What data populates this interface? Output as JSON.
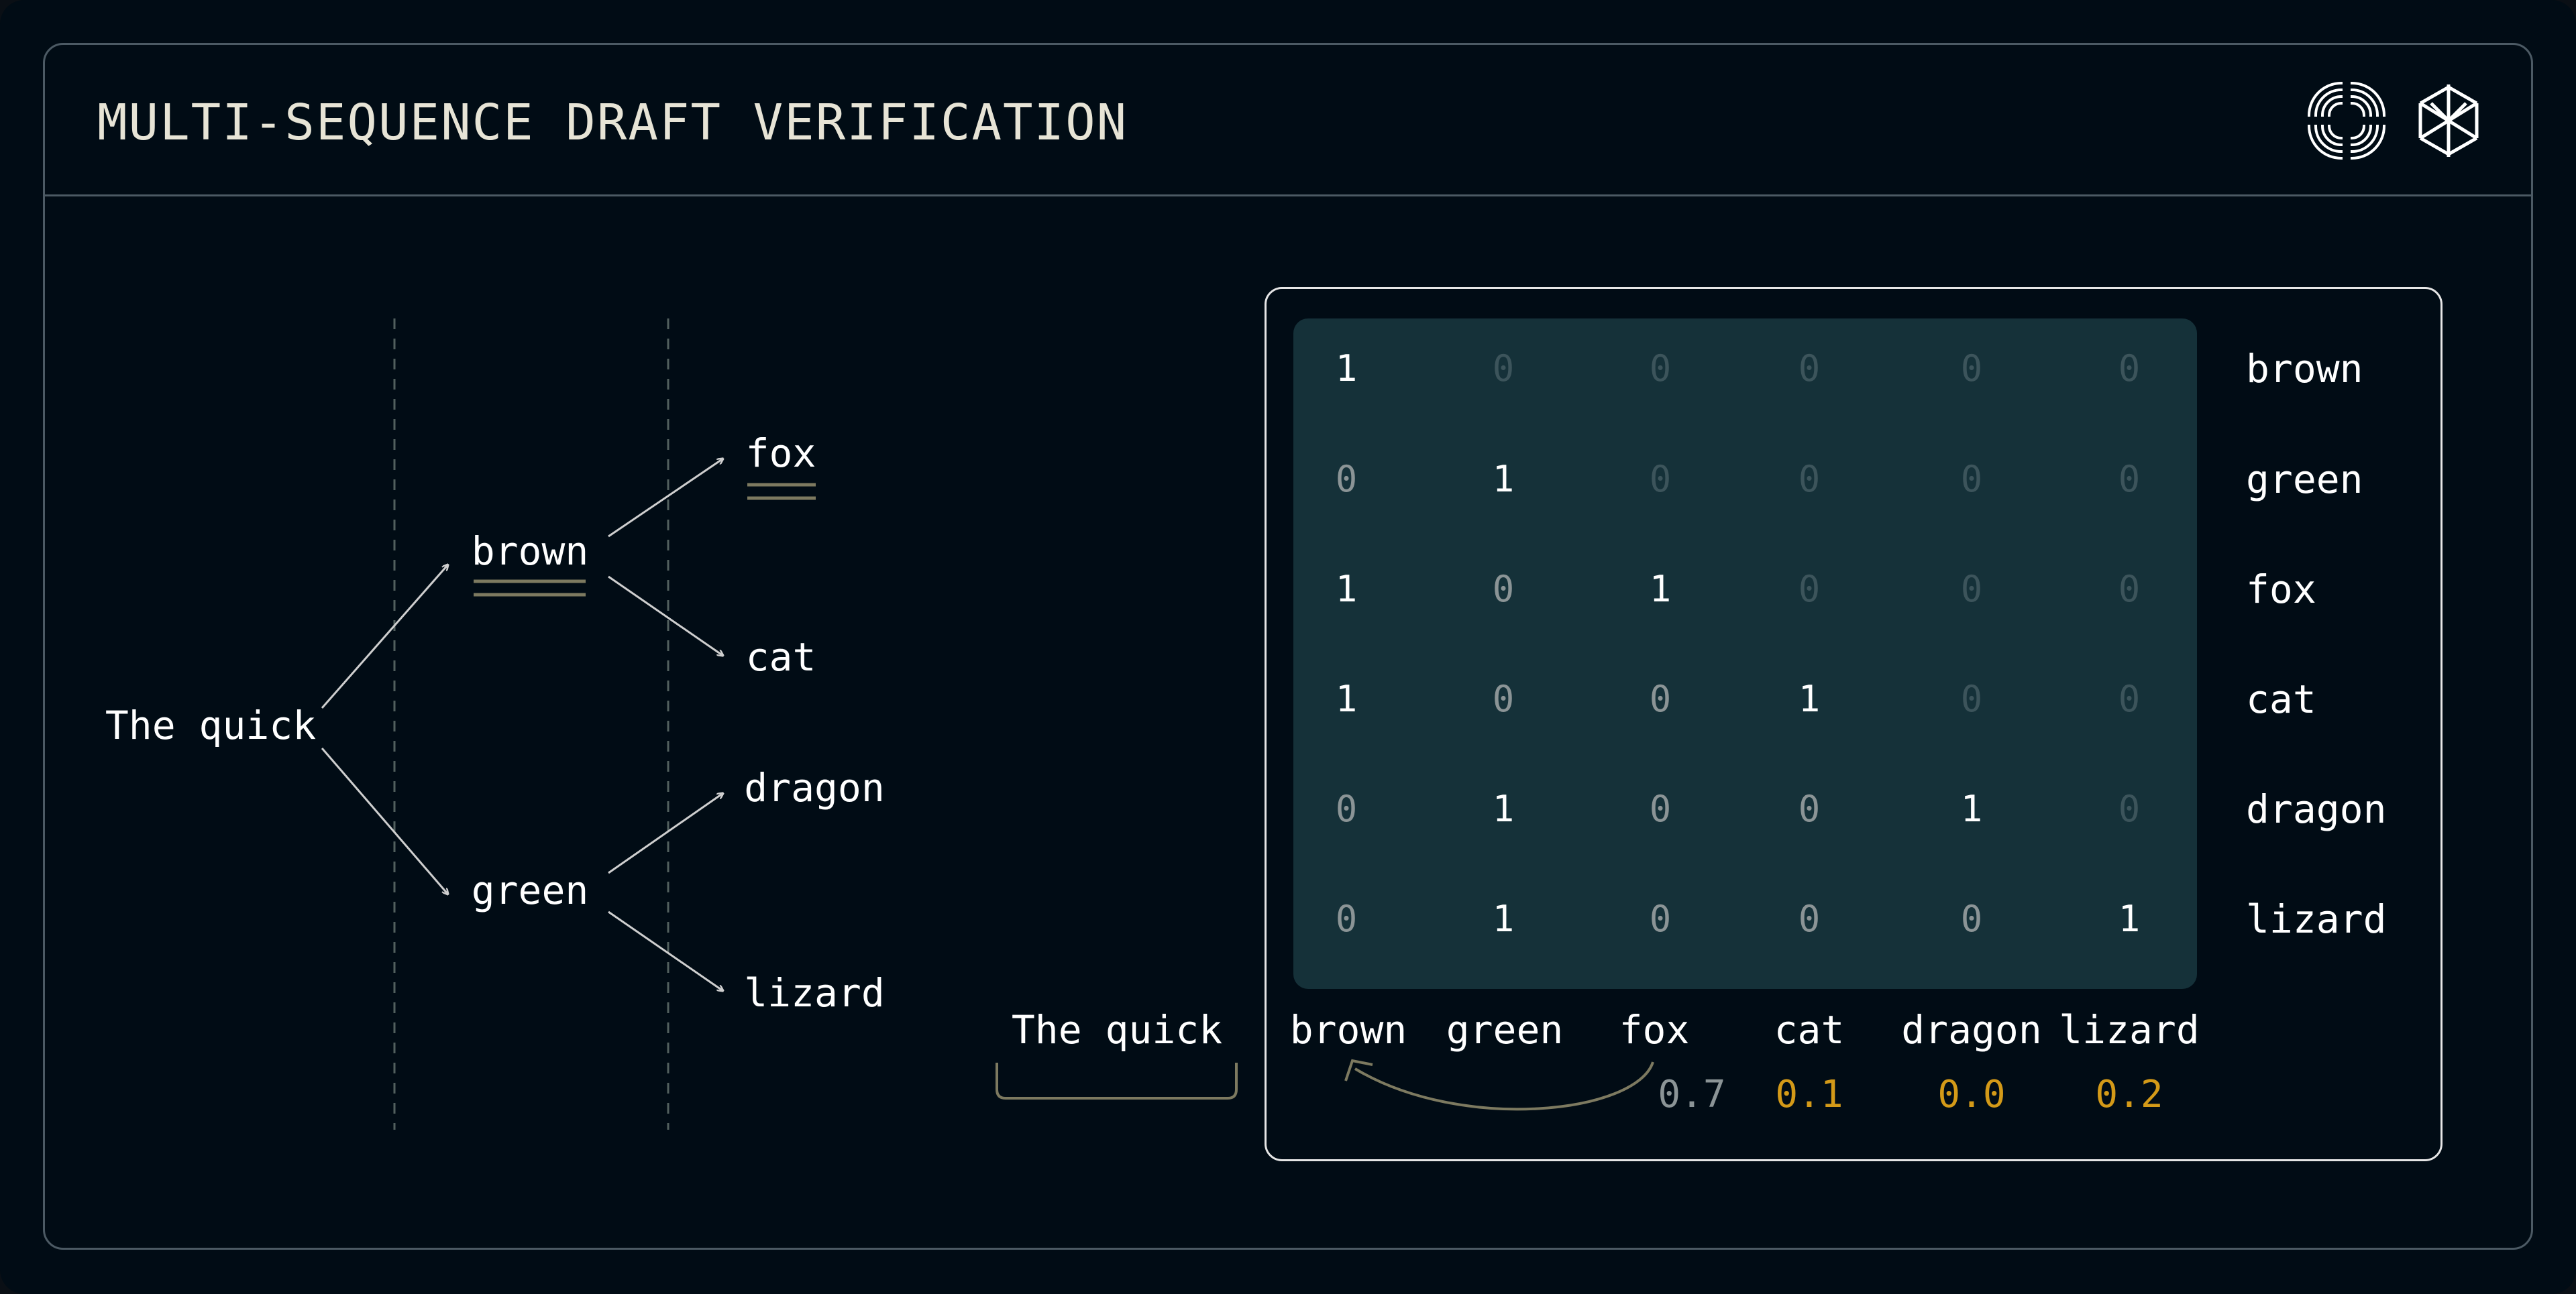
{
  "title": "MULTI-SEQUENCE DRAFT VERIFICATION",
  "colors": {
    "background": "#010c15",
    "border": "#4c5a64",
    "title_text": "#e7e4d6",
    "text": "#ffffff",
    "muted_line": "#7d7a60",
    "matrix_bg": "#153139",
    "accept_prob": "#8b9496",
    "reject_prob": "#d49a18"
  },
  "tree": {
    "root": "The quick",
    "level1": [
      "brown",
      "green"
    ],
    "level2": [
      "fox",
      "cat",
      "dragon",
      "lizard"
    ]
  },
  "matrix": {
    "row_labels": [
      "brown",
      "green",
      "fox",
      "cat",
      "dragon",
      "lizard"
    ],
    "prefix_label": "The quick",
    "col_labels": [
      "brown",
      "green",
      "fox",
      "cat",
      "dragon",
      "lizard"
    ],
    "rows": [
      [
        "1",
        "0",
        "0",
        "0",
        "0",
        "0"
      ],
      [
        "0",
        "1",
        "0",
        "0",
        "0",
        "0"
      ],
      [
        "1",
        "0",
        "1",
        "0",
        "0",
        "0"
      ],
      [
        "1",
        "0",
        "0",
        "1",
        "0",
        "0"
      ],
      [
        "0",
        "1",
        "0",
        "0",
        "1",
        "0"
      ],
      [
        "0",
        "1",
        "0",
        "0",
        "0",
        "1"
      ]
    ],
    "probabilities": [
      "0.7",
      "0.1",
      "0.0",
      "0.2"
    ]
  },
  "icons": [
    "lens-logo-icon",
    "crystal-logo-icon"
  ]
}
